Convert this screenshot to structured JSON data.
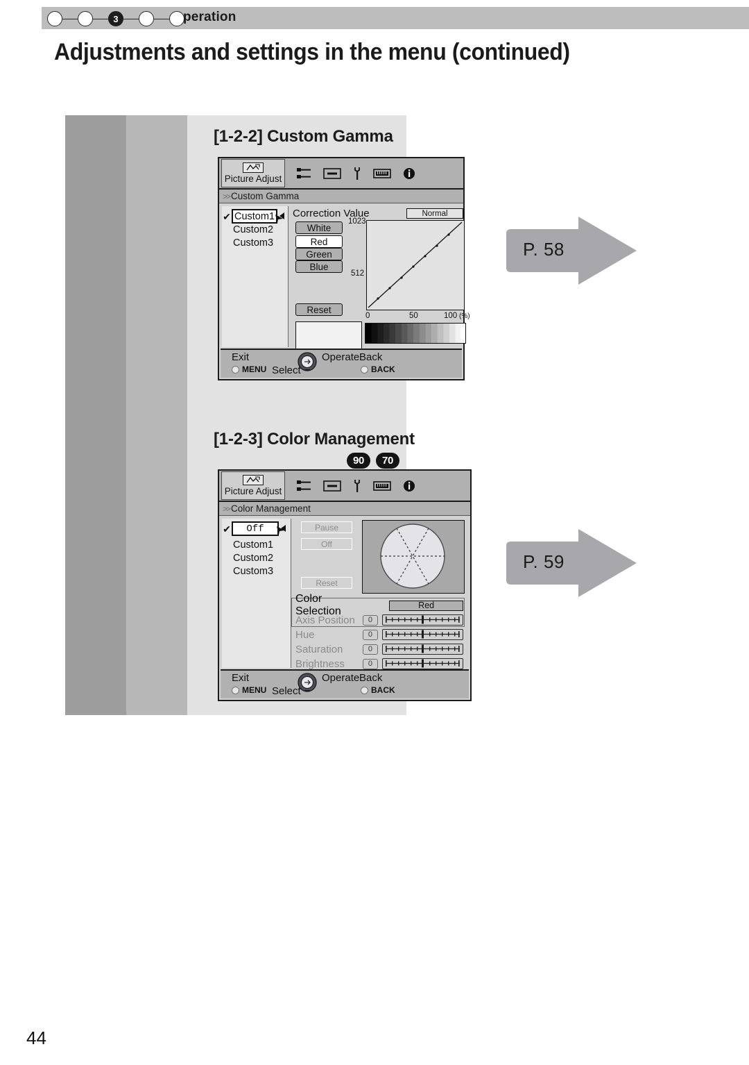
{
  "chapter": {
    "label": "Operation",
    "steps": [
      "",
      "",
      "3",
      "",
      ""
    ],
    "active_index": 2
  },
  "page": {
    "title": "Adjustments and settings in the menu (continued)",
    "number": "44"
  },
  "sections": [
    {
      "id": "custom-gamma",
      "title": "[1-2-2] Custom Gamma",
      "badges": [],
      "menu": {
        "tab_label": "Picture Adjust",
        "tab_icons": [
          "picture-adjust-icon",
          "sliders-icon",
          "display-icon",
          "wrench-icon",
          "installation-icon",
          "info-icon"
        ],
        "breadcrumb": "Custom Gamma",
        "selected_item": "Custom1",
        "list_items": [
          "Custom2",
          "Custom3"
        ],
        "content_label": "Correction Value",
        "preset_button": "Normal",
        "channel_buttons": [
          {
            "label": "White",
            "style": "gray"
          },
          {
            "label": "Red",
            "style": "white"
          },
          {
            "label": "Green",
            "style": "gray"
          },
          {
            "label": "Blue",
            "style": "gray"
          }
        ],
        "reset_button": "Reset",
        "graph": {
          "y_top": "1023",
          "y_mid": "512",
          "x_ticks": [
            "0",
            "50",
            "100"
          ],
          "x_unit": "(%)"
        },
        "help": {
          "exit": "Exit",
          "menu_key": "MENU",
          "select": "Select",
          "operate": "Operate",
          "back": "Back",
          "back_key": "BACK"
        }
      },
      "page_ref": "P. 58"
    },
    {
      "id": "color-management",
      "title": "[1-2-3] Color Management",
      "badges": [
        "90",
        "70"
      ],
      "menu": {
        "tab_label": "Picture Adjust",
        "tab_icons": [
          "picture-adjust-icon",
          "sliders-icon",
          "display-icon",
          "wrench-icon",
          "installation-icon",
          "info-icon"
        ],
        "breadcrumb": "Color Management",
        "selected_item": "Off",
        "list_items": [
          "Custom1",
          "Custom2",
          "Custom3"
        ],
        "action_buttons": [
          "Pause",
          "Off"
        ],
        "reset_button": "Reset",
        "color_selection_label": "Color Selection",
        "color_selection_value": "Red",
        "sliders": [
          {
            "name": "Axis Position",
            "value": "0"
          },
          {
            "name": "Hue",
            "value": "0"
          },
          {
            "name": "Saturation",
            "value": "0"
          },
          {
            "name": "Brightness",
            "value": "0"
          }
        ],
        "help": {
          "exit": "Exit",
          "menu_key": "MENU",
          "select": "Select",
          "operate": "Operate",
          "back": "Back",
          "back_key": "BACK"
        }
      },
      "page_ref": "P. 59"
    }
  ],
  "colors": {
    "chapter_bar": "#bdbdbd",
    "band_dark": "#9d9d9d",
    "band_mid": "#b7b7b7",
    "band_light": "#e2e2e2",
    "arrow": "#a8a8ac",
    "badge": "#141414"
  }
}
